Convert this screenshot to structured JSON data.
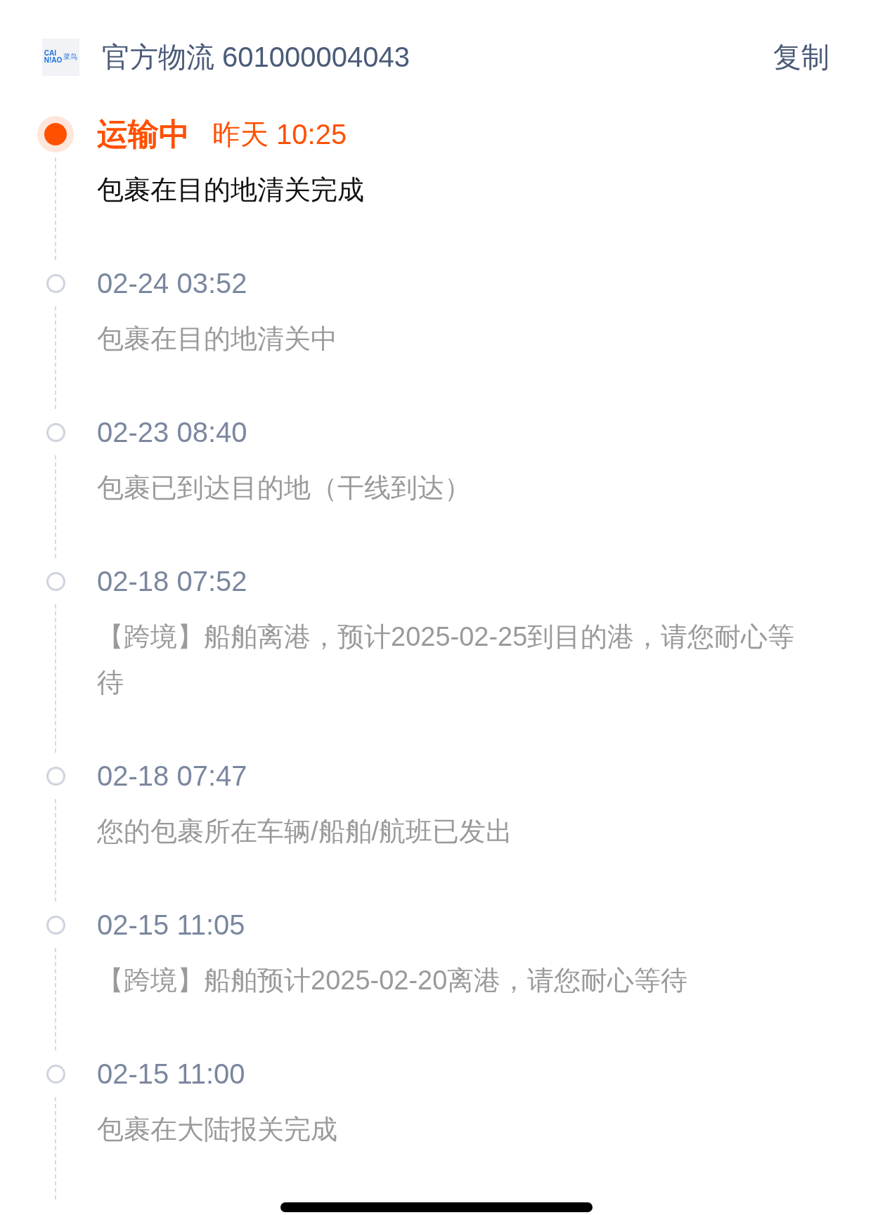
{
  "header": {
    "logo": {
      "line_1": "CAI",
      "line_2": "N!AO",
      "mark": "菜鸟"
    },
    "title": "官方物流 601000004043",
    "copy_button": "复制"
  },
  "events": [
    {
      "current": true,
      "status": "运输中",
      "time": "昨天 10:25",
      "description": "包裹在目的地清关完成"
    },
    {
      "current": false,
      "time": "02-24 03:52",
      "description": "包裹在目的地清关中"
    },
    {
      "current": false,
      "time": "02-23 08:40",
      "description": "包裹已到达目的地（干线到达）"
    },
    {
      "current": false,
      "time": "02-18 07:52",
      "description": "【跨境】船舶离港，预计2025-02-25到目的港，请您耐心等待"
    },
    {
      "current": false,
      "time": "02-18 07:47",
      "description": "您的包裹所在车辆/船舶/航班已发出"
    },
    {
      "current": false,
      "time": "02-15 11:05",
      "description": "【跨境】船舶预计2025-02-20离港，请您耐心等待"
    },
    {
      "current": false,
      "time": "02-15 11:00",
      "description": "包裹在大陆报关完成"
    }
  ]
}
